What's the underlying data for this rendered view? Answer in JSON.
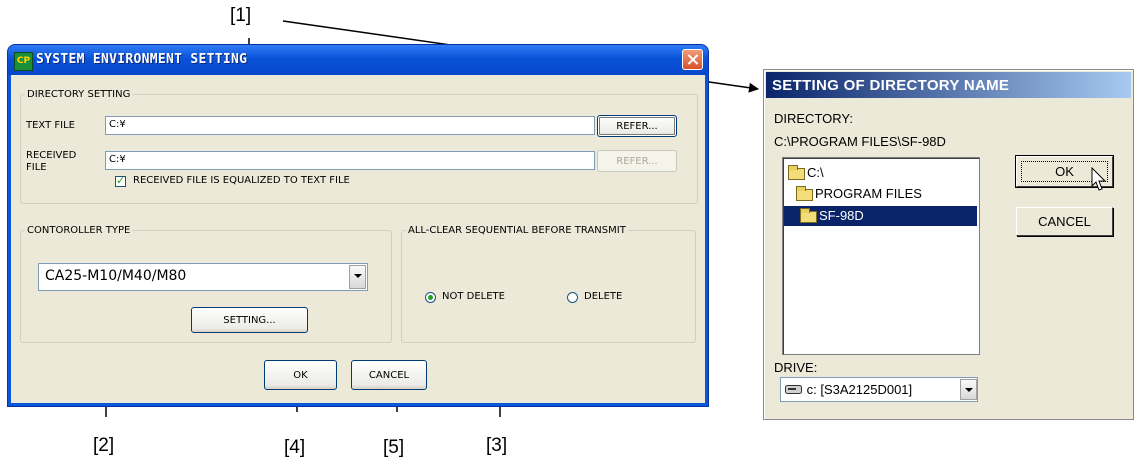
{
  "callouts": {
    "c1": "[1]",
    "c2": "[2]",
    "c3": "[3]",
    "c4": "[4]",
    "c5": "[5]"
  },
  "main_dialog": {
    "title": "SYSTEM ENVIRONMENT SETTING",
    "app_icon_text": "CP",
    "directory_group": "DIRECTORY SETTING",
    "text_file_label": "TEXT FILE",
    "text_file_value": "C:¥",
    "refer_label": "REFER...",
    "received_file_label": "RECEIVED\nFILE",
    "received_file_value": "C:¥",
    "refer2_label": "REFER...",
    "equalize_label": "RECEIVED FILE IS EQUALIZED TO TEXT FILE",
    "equalize_checked": true,
    "controller_group": "CONTOROLLER TYPE",
    "controller_value": "CA25-M10/M40/M80",
    "setting_label": "SETTING...",
    "allclear_group": "ALL-CLEAR SEQUENTIAL BEFORE TRANSMIT",
    "not_delete_label": "NOT DELETE",
    "delete_label": "DELETE",
    "selected_option": "NOT DELETE",
    "ok_label": "OK",
    "cancel_label": "CANCEL"
  },
  "dir_dialog": {
    "title": "SETTING OF DIRECTORY NAME",
    "directory_label": "DIRECTORY:",
    "current_path": "C:\\PROGRAM FILES\\SF-98D",
    "tree": [
      "C:\\",
      "PROGRAM FILES",
      "SF-98D"
    ],
    "selected_item": "SF-98D",
    "ok_label": "OK",
    "cancel_label": "CANCEL",
    "drive_label": "DRIVE:",
    "drive_value": "c: [S3A2125D001]"
  },
  "colors": {
    "xp_title": "#0a56d8",
    "face": "#ece9d8",
    "selection": "#0a246a"
  }
}
